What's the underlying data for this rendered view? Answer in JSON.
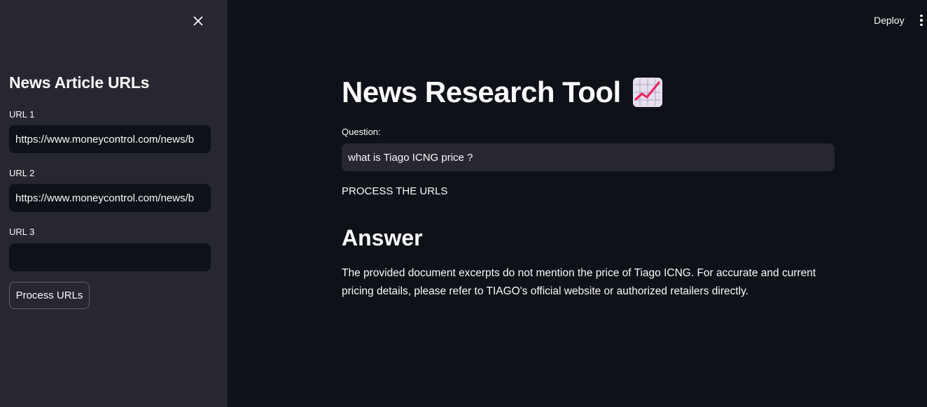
{
  "sidebar": {
    "title": "News Article URLs",
    "close_icon": "close-icon",
    "url_fields": [
      {
        "label": "URL 1",
        "value": "https://www.moneycontrol.com/news/b"
      },
      {
        "label": "URL 2",
        "value": "https://www.moneycontrol.com/news/b"
      },
      {
        "label": "URL 3",
        "value": ""
      }
    ],
    "process_button_label": "Process URLs"
  },
  "header": {
    "deploy_label": "Deploy",
    "menu_icon": "more-vertical-icon"
  },
  "main": {
    "title": "News Research Tool",
    "title_icon": "chart-increasing-emoji",
    "question_label": "Question:",
    "question_value": "what is Tiago ICNG price ?",
    "status_text": "PROCESS THE URLS",
    "answer_heading": "Answer",
    "answer_text": "The provided document excerpts do not mention the price of Tiago ICNG. For accurate and current pricing details, please refer to TIAGO's official website or authorized retailers directly."
  },
  "colors": {
    "background": "#0e1117",
    "sidebar": "#262730",
    "text": "#fafafa",
    "emoji_line": "#e8265e"
  }
}
